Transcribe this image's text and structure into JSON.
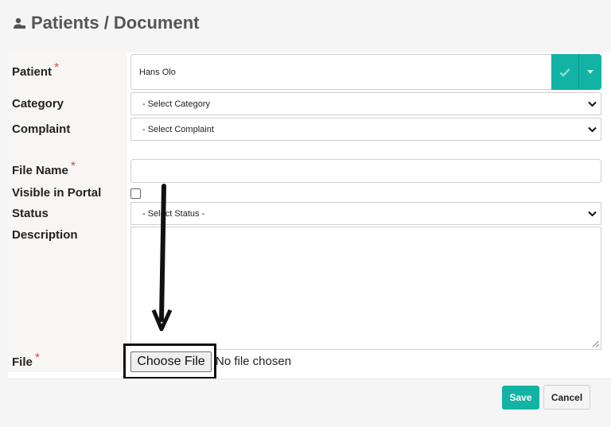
{
  "header": {
    "title": "Patients / Document",
    "icon": "patient-icon"
  },
  "form": {
    "patient": {
      "label": "Patient",
      "value": "Hans Olo",
      "required_mark": "*"
    },
    "category": {
      "label": "Category",
      "selected": "- Select Category"
    },
    "complaint": {
      "label": "Complaint",
      "selected": "- Select Complaint"
    },
    "file_name": {
      "label": "File Name",
      "value": "",
      "required_mark": "*"
    },
    "visible_in_portal": {
      "label": "Visible in Portal",
      "checked": false
    },
    "status": {
      "label": "Status",
      "selected": "- Select Status -"
    },
    "description": {
      "label": "Description",
      "value": ""
    },
    "file": {
      "label": "File",
      "button_label": "Choose File",
      "status_text": "No file chosen",
      "required_mark": "*"
    }
  },
  "actions": {
    "save_label": "Save",
    "cancel_label": "Cancel"
  },
  "colors": {
    "accent": "#12b3a5",
    "required": "#d9534f",
    "annotation": "#111111"
  }
}
